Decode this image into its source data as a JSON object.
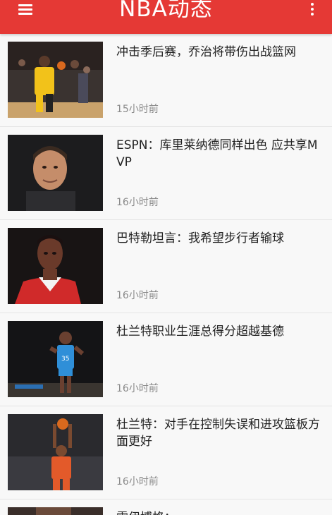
{
  "toolbar": {
    "title": "NBA动态",
    "color": "#e53935",
    "menu_icon": "hamburger-menu-icon",
    "more_icon": "overflow-menu-icon"
  },
  "news": [
    {
      "headline": "冲击季后赛，乔治将带伤出战篮网",
      "time": "15小时前"
    },
    {
      "headline": "ESPN：库里莱纳德同样出色 应共享MVP",
      "time": "16小时前"
    },
    {
      "headline": "巴特勒坦言：我希望步行者输球",
      "time": "16小时前"
    },
    {
      "headline": "杜兰特职业生涯总得分超越基德",
      "time": "16小时前"
    },
    {
      "headline": "杜兰特：对手在控制失误和进攻篮板方面更好",
      "time": "16小时前"
    },
    {
      "headline": "雷伊博格：",
      "time": ""
    }
  ]
}
